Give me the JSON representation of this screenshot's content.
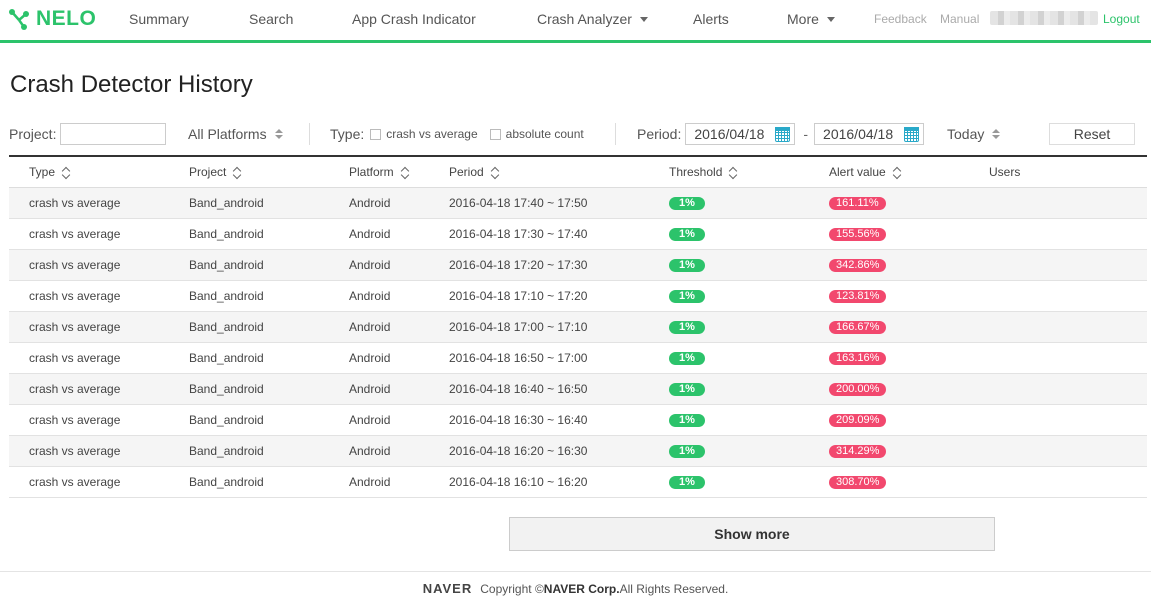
{
  "app": {
    "logo_text": "NELO",
    "brand_color": "#2cc36b"
  },
  "nav": {
    "items": [
      {
        "label": "Summary"
      },
      {
        "label": "Search"
      },
      {
        "label": "App Crash Indicator"
      },
      {
        "label": "Crash Analyzer"
      },
      {
        "label": "Alerts"
      },
      {
        "label": "More"
      }
    ],
    "feedback": "Feedback",
    "manual": "Manual",
    "logout": "Logout"
  },
  "page": {
    "title": "Crash Detector History"
  },
  "filters": {
    "project_label": "Project:",
    "project_value": "",
    "platform_value": "All Platforms",
    "type_label": "Type:",
    "type_options": [
      {
        "label": "crash vs average",
        "checked": false
      },
      {
        "label": "absolute count",
        "checked": false
      }
    ],
    "period_label": "Period:",
    "period_from": "2016/04/18",
    "period_sep": "-",
    "period_to": "2016/04/18",
    "range_preset": "Today",
    "reset_label": "Reset"
  },
  "table": {
    "columns": [
      "Type",
      "Project",
      "Platform",
      "Period",
      "Threshold",
      "Alert value",
      "Users"
    ],
    "rows": [
      {
        "type": "crash vs average",
        "project": "Band_android",
        "platform": "Android",
        "period": "2016-04-18 17:40 ~ 17:50",
        "threshold": "1%",
        "alert": "161.11%",
        "users": ""
      },
      {
        "type": "crash vs average",
        "project": "Band_android",
        "platform": "Android",
        "period": "2016-04-18 17:30 ~ 17:40",
        "threshold": "1%",
        "alert": "155.56%",
        "users": ""
      },
      {
        "type": "crash vs average",
        "project": "Band_android",
        "platform": "Android",
        "period": "2016-04-18 17:20 ~ 17:30",
        "threshold": "1%",
        "alert": "342.86%",
        "users": ""
      },
      {
        "type": "crash vs average",
        "project": "Band_android",
        "platform": "Android",
        "period": "2016-04-18 17:10 ~ 17:20",
        "threshold": "1%",
        "alert": "123.81%",
        "users": ""
      },
      {
        "type": "crash vs average",
        "project": "Band_android",
        "platform": "Android",
        "period": "2016-04-18 17:00 ~ 17:10",
        "threshold": "1%",
        "alert": "166.67%",
        "users": ""
      },
      {
        "type": "crash vs average",
        "project": "Band_android",
        "platform": "Android",
        "period": "2016-04-18 16:50 ~ 17:00",
        "threshold": "1%",
        "alert": "163.16%",
        "users": ""
      },
      {
        "type": "crash vs average",
        "project": "Band_android",
        "platform": "Android",
        "period": "2016-04-18 16:40 ~ 16:50",
        "threshold": "1%",
        "alert": "200.00%",
        "users": ""
      },
      {
        "type": "crash vs average",
        "project": "Band_android",
        "platform": "Android",
        "period": "2016-04-18 16:30 ~ 16:40",
        "threshold": "1%",
        "alert": "209.09%",
        "users": ""
      },
      {
        "type": "crash vs average",
        "project": "Band_android",
        "platform": "Android",
        "period": "2016-04-18 16:20 ~ 16:30",
        "threshold": "1%",
        "alert": "314.29%",
        "users": ""
      },
      {
        "type": "crash vs average",
        "project": "Band_android",
        "platform": "Android",
        "period": "2016-04-18 16:10 ~ 16:20",
        "threshold": "1%",
        "alert": "308.70%",
        "users": ""
      }
    ],
    "threshold_color": "#2cc36b",
    "alert_color": "#f2486e"
  },
  "show_more_label": "Show more",
  "footer": {
    "logo": "NAVER",
    "copyright_prefix": "Copyright ©",
    "copyright_company": "NAVER Corp.",
    "copyright_suffix": " All Rights Reserved."
  }
}
